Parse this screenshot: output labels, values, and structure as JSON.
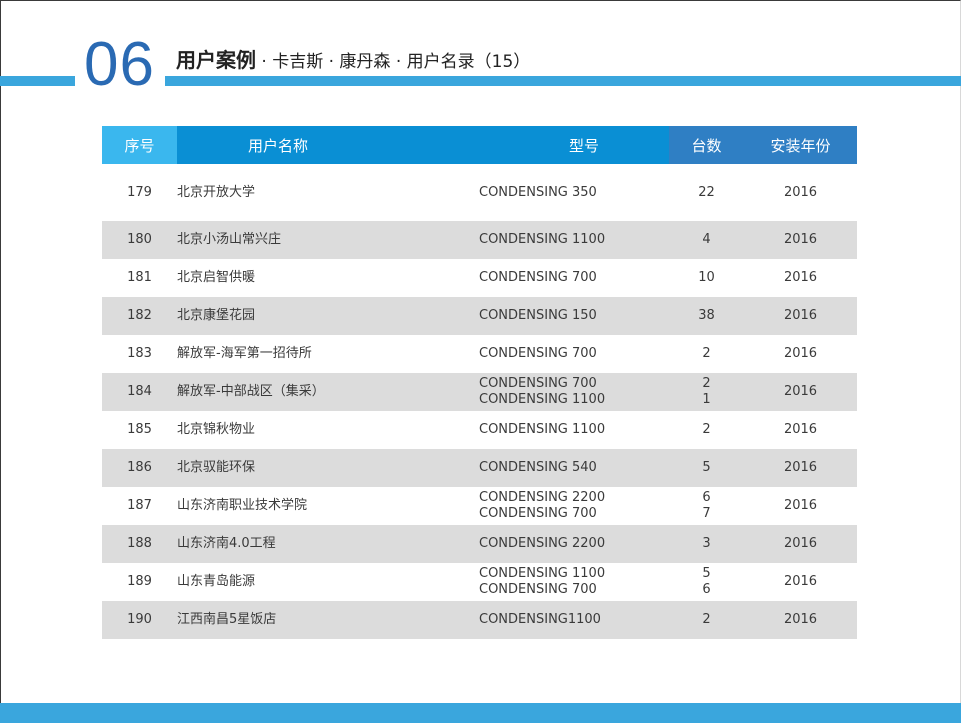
{
  "header": {
    "section_number": "06",
    "title_main": "用户案例",
    "title_sub": " · 卡吉斯 · 康丹森 · 用户名录（15）"
  },
  "table": {
    "columns": [
      "序号",
      "用户名称",
      "型号",
      "台数",
      "安装年份"
    ],
    "rows": [
      {
        "seq": "179",
        "name": "北京开放大学",
        "models": [
          "CONDENSING 350"
        ],
        "qtys": [
          "22"
        ],
        "year": "2016"
      },
      {
        "seq": "180",
        "name": "北京小汤山常兴庄",
        "models": [
          "CONDENSING 1100"
        ],
        "qtys": [
          "4"
        ],
        "year": "2016"
      },
      {
        "seq": "181",
        "name": "北京启智供暖",
        "models": [
          "CONDENSING 700"
        ],
        "qtys": [
          "10"
        ],
        "year": "2016"
      },
      {
        "seq": "182",
        "name": "北京康堡花园",
        "models": [
          "CONDENSING 150"
        ],
        "qtys": [
          "38"
        ],
        "year": "2016"
      },
      {
        "seq": "183",
        "name": "解放军-海军第一招待所",
        "models": [
          "CONDENSING 700"
        ],
        "qtys": [
          "2"
        ],
        "year": "2016"
      },
      {
        "seq": "184",
        "name": "解放军-中部战区（集采）",
        "models": [
          "CONDENSING 700",
          "CONDENSING 1100"
        ],
        "qtys": [
          "2",
          "1"
        ],
        "year": "2016"
      },
      {
        "seq": "185",
        "name": "北京锦秋物业",
        "models": [
          "CONDENSING 1100"
        ],
        "qtys": [
          "2"
        ],
        "year": "2016"
      },
      {
        "seq": "186",
        "name": "北京驭能环保",
        "models": [
          "CONDENSING 540"
        ],
        "qtys": [
          "5"
        ],
        "year": "2016"
      },
      {
        "seq": "187",
        "name": "山东济南职业技术学院",
        "models": [
          "CONDENSING 2200",
          "CONDENSING 700"
        ],
        "qtys": [
          "6",
          "7"
        ],
        "year": "2016"
      },
      {
        "seq": "188",
        "name": "山东济南4.0工程",
        "models": [
          "CONDENSING 2200"
        ],
        "qtys": [
          "3"
        ],
        "year": "2016"
      },
      {
        "seq": "189",
        "name": "山东青岛能源",
        "models": [
          "CONDENSING 1100",
          "CONDENSING 700"
        ],
        "qtys": [
          "5",
          "6"
        ],
        "year": "2016"
      },
      {
        "seq": "190",
        "name": "江西南昌5星饭店",
        "models": [
          "CONDENSING1100"
        ],
        "qtys": [
          "2"
        ],
        "year": "2016"
      }
    ]
  },
  "colors": {
    "accent": "#3aa6dd",
    "section_number": "#2a6ab3",
    "header_seq": "#3ab7ee",
    "header_mid": "#0a8fd4",
    "header_right": "#2f7fc4",
    "row_shade": "#dcdcdc"
  }
}
